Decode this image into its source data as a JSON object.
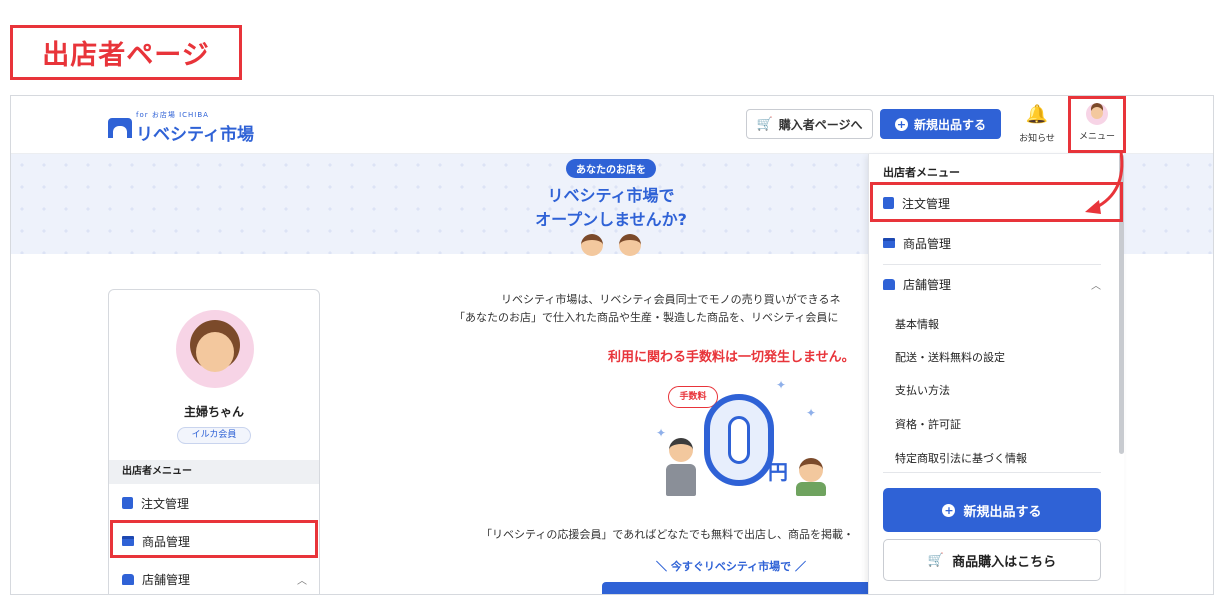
{
  "page_label": "出店者ページ",
  "header": {
    "logo_small": "for お店場 ICHIBA",
    "logo_text": "リベシティ市場",
    "buyer_button": "購入者ページへ",
    "new_listing_button": "新規出品する",
    "notifications_label": "お知らせ",
    "menu_label": "メニュー"
  },
  "banner": {
    "pill": "あなたのお店を",
    "line1": "リベシティ市場で",
    "line2": "オープンしませんか?"
  },
  "profile": {
    "name": "主婦ちゃん",
    "badge": "イルカ会員",
    "section_title": "出店者メニュー",
    "items": [
      "注文管理",
      "商品管理",
      "店舗管理"
    ]
  },
  "main": {
    "intro_line1": "リベシティ市場は、リベシティ会員同士でモノの売り買いができるネ",
    "intro_line2": "「あなたのお店」で仕入れた商品や生産・製造した商品を、リベシティ会員に",
    "fee_notice": "利用に関わる手数料は一切発生しません。",
    "fee_bubble": "手数料",
    "zero_yen_suffix": "円",
    "supporter_line": "「リベシティの応援会員」であればどなたでも無料で出店し、商品を掲載・",
    "cta_line": "＼ 今すぐリベシティ市場で ／"
  },
  "dropdown": {
    "title": "出店者メニュー",
    "items": [
      "注文管理",
      "商品管理",
      "店舗管理"
    ],
    "sub_items": [
      "基本情報",
      "配送・送料無料の設定",
      "支払い方法",
      "資格・許可証",
      "特定商取引法に基づく情報"
    ],
    "new_listing_button": "新規出品する",
    "buy_button": "商品購入はこちら"
  },
  "colors": {
    "accent": "#2f62d6",
    "highlight": "#e8343a",
    "cart": "#f07a24"
  }
}
